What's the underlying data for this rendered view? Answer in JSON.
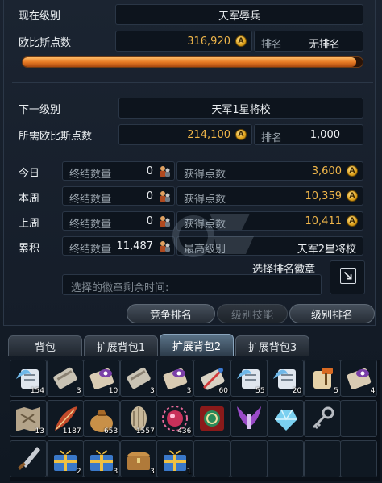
{
  "current": {
    "label": "现在级别",
    "rank": "天军辱兵"
  },
  "points": {
    "label": "欧比斯点数",
    "value": "316,920",
    "rank_label": "排名",
    "rank_value": "无排名"
  },
  "progress": 0.98,
  "next": {
    "label": "下一级别",
    "rank": "天军1星将校"
  },
  "required": {
    "label": "所需欧比斯点数",
    "value": "214,100",
    "rank_label": "排名",
    "rank_value": "1,000"
  },
  "stats": [
    {
      "period": "今日",
      "kill_label": "终结数量",
      "kill_value": "0",
      "gain_label": "获得点数",
      "gain_value": "3,600"
    },
    {
      "period": "本周",
      "kill_label": "终结数量",
      "kill_value": "0",
      "gain_label": "获得点数",
      "gain_value": "10,359"
    },
    {
      "period": "上周",
      "kill_label": "终结数量",
      "kill_value": "0",
      "gain_label": "获得点数",
      "gain_value": "10,411"
    }
  ],
  "total": {
    "period": "累积",
    "kill_label": "终结数量",
    "kill_value": "11,487",
    "max_label": "最高级别",
    "max_value": "天军2星将校"
  },
  "badge": {
    "select_label": "选择排名徽章",
    "remaining_label": "选择的徽章剩余时间:"
  },
  "buttons": {
    "compete": "竞争排名",
    "skill": "级别技能",
    "rank": "级别排名"
  },
  "coin_letter": "A",
  "tabs": [
    {
      "label": "背包",
      "active": false
    },
    {
      "label": "扩展背包1",
      "active": false
    },
    {
      "label": "扩展背包2",
      "active": true
    },
    {
      "label": "扩展背包3",
      "active": false
    }
  ],
  "inventory": [
    {
      "icon": "wing-scroll-icon",
      "count": "154"
    },
    {
      "icon": "scroll-icon",
      "count": "3"
    },
    {
      "icon": "eye-scroll-icon",
      "count": "10"
    },
    {
      "icon": "scroll-icon",
      "count": "3"
    },
    {
      "icon": "eye-scroll-icon",
      "count": "3"
    },
    {
      "icon": "sword-scroll-icon",
      "count": "60"
    },
    {
      "icon": "wing-scroll-icon",
      "count": "55"
    },
    {
      "icon": "wing-scroll-icon",
      "count": "20"
    },
    {
      "icon": "hammer-scroll-icon",
      "count": "5"
    },
    {
      "icon": "eye-scroll-icon",
      "count": "4"
    },
    {
      "icon": "map-icon",
      "count": "13"
    },
    {
      "icon": "feather-icon",
      "count": "1187"
    },
    {
      "icon": "bag-icon",
      "count": "653"
    },
    {
      "icon": "seed-icon",
      "count": "1557"
    },
    {
      "icon": "orb-icon",
      "count": "436"
    },
    {
      "icon": "emblem-icon",
      "count": ""
    },
    {
      "icon": "wings-icon",
      "count": ""
    },
    {
      "icon": "crystal-icon",
      "count": ""
    },
    {
      "icon": "key-icon",
      "count": ""
    },
    {
      "icon": "empty",
      "count": ""
    },
    {
      "icon": "dagger-icon",
      "count": ""
    },
    {
      "icon": "gift-box-icon",
      "count": "2"
    },
    {
      "icon": "gift-box-icon",
      "count": "3"
    },
    {
      "icon": "chest-icon",
      "count": "3"
    },
    {
      "icon": "gift-box-icon",
      "count": "1"
    },
    {
      "icon": "empty",
      "count": ""
    },
    {
      "icon": "empty",
      "count": ""
    },
    {
      "icon": "empty",
      "count": ""
    },
    {
      "icon": "empty",
      "count": ""
    },
    {
      "icon": "empty",
      "count": ""
    }
  ]
}
